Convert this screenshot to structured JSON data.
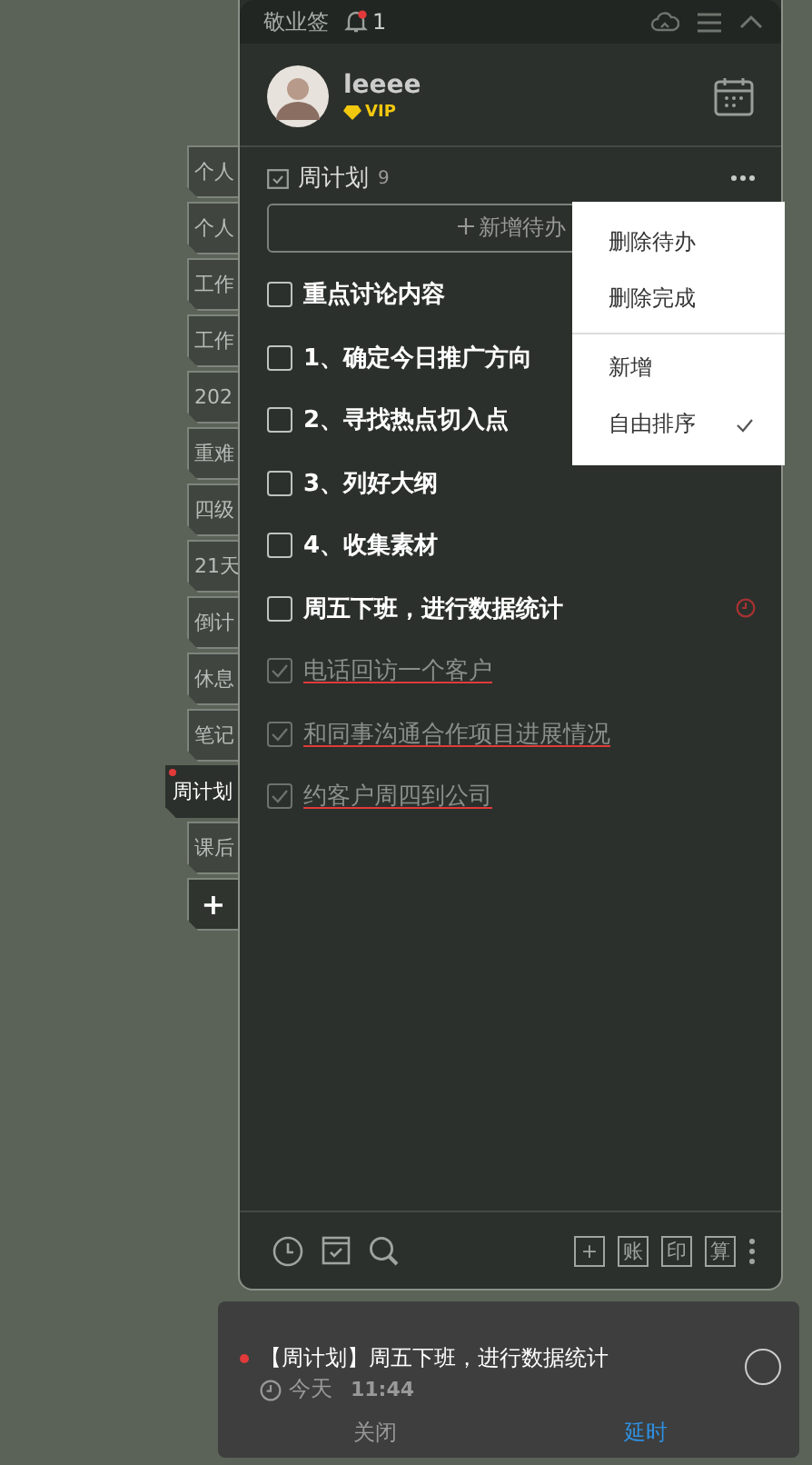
{
  "header": {
    "app_name": "敬业签",
    "notification_count": "1"
  },
  "user": {
    "name": "leeee",
    "badge": "VIP"
  },
  "side_tabs": [
    {
      "label": "个人",
      "selected": false
    },
    {
      "label": "个人",
      "selected": false
    },
    {
      "label": "工作",
      "selected": false
    },
    {
      "label": "工作",
      "selected": false
    },
    {
      "label": "202",
      "selected": false
    },
    {
      "label": "重难",
      "selected": false
    },
    {
      "label": "四级",
      "selected": false
    },
    {
      "label": "21天",
      "selected": false
    },
    {
      "label": "倒计",
      "selected": false
    },
    {
      "label": "休息",
      "selected": false
    },
    {
      "label": "笔记",
      "selected": false
    },
    {
      "label": "周计划",
      "selected": true
    },
    {
      "label": "课后",
      "selected": false
    }
  ],
  "add_tab": "+",
  "list": {
    "title": "周计划",
    "count": "9",
    "new_button": "新增待办",
    "items": [
      {
        "text": "重点讨论内容",
        "checked": false,
        "reminder": false
      },
      {
        "text": "1、确定今日推广方向",
        "checked": false,
        "reminder": false
      },
      {
        "text": "2、寻找热点切入点",
        "checked": false,
        "reminder": false
      },
      {
        "text": "3、列好大纲",
        "checked": false,
        "reminder": false
      },
      {
        "text": "4、收集素材",
        "checked": false,
        "reminder": false
      },
      {
        "text": "周五下班，进行数据统计",
        "checked": false,
        "reminder": true
      },
      {
        "text": "电话回访一个客户",
        "checked": true,
        "reminder": false
      },
      {
        "text": "和同事沟通合作项目进展情况",
        "checked": true,
        "reminder": false
      },
      {
        "text": "约客户周四到公司",
        "checked": true,
        "reminder": false
      }
    ]
  },
  "menu": {
    "groups": [
      [
        {
          "label": "删除待办",
          "checked": false
        },
        {
          "label": "删除完成",
          "checked": false
        }
      ],
      [
        {
          "label": "新增",
          "checked": false
        },
        {
          "label": "自由排序",
          "checked": true
        }
      ]
    ]
  },
  "toolbar": {
    "text_buttons": [
      "+",
      "账",
      "印",
      "算"
    ]
  },
  "notification": {
    "title": "【周计划】周五下班，进行数据统计",
    "day": "今天",
    "time": "11:44",
    "close": "关闭",
    "snooze": "延时"
  }
}
